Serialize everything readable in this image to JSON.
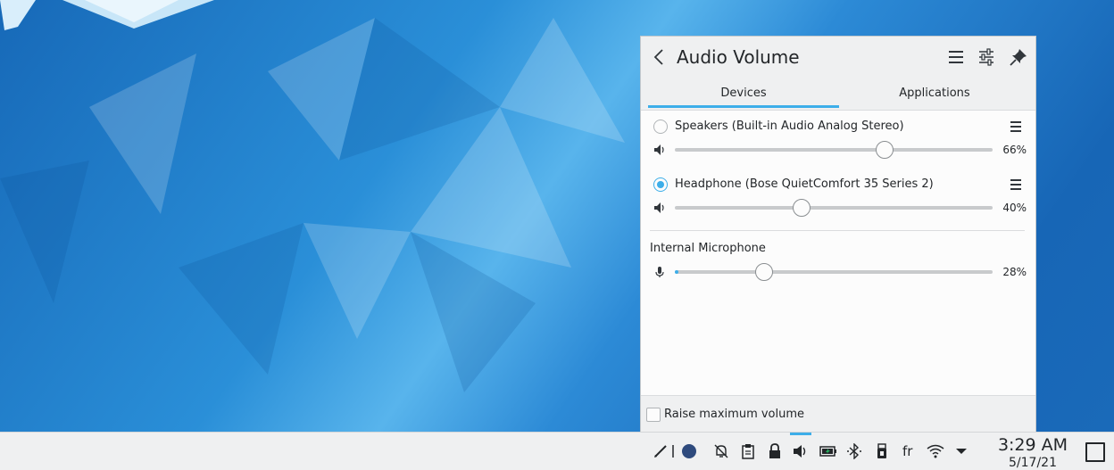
{
  "panel": {
    "title": "Audio Volume",
    "tabs": [
      {
        "label": "Devices",
        "active": true
      },
      {
        "label": "Applications",
        "active": false
      }
    ],
    "devices": [
      {
        "name": "Speakers (Built-in Audio Analog Stereo)",
        "selected": false,
        "volume": 66,
        "volume_text": "66%"
      },
      {
        "name": "Headphone (Bose QuietComfort 35 Series 2)",
        "selected": true,
        "volume": 40,
        "volume_text": "40%"
      }
    ],
    "microphone": {
      "label": "Internal Microphone",
      "volume": 28,
      "volume_text": "28%"
    },
    "footer": {
      "raise_max_label": "Raise maximum volume",
      "checked": false
    }
  },
  "taskbar": {
    "tray_icons": [
      "pen-icon",
      "separator-icon",
      "color-dot-icon",
      "notifications-disabled-icon",
      "clipboard-icon",
      "lock-icon",
      "volume-icon",
      "battery-icon",
      "bluetooth-icon",
      "usb-device-icon",
      "keyboard-layout-icon",
      "wifi-icon",
      "expand-tray-icon"
    ],
    "keyboard_layout": "fr",
    "clock_time": "3:29 AM",
    "clock_date": "5/17/21"
  },
  "colors": {
    "accent": "#3daee9",
    "panel_bg": "#eff0f1",
    "content_bg": "#fcfcfc",
    "text": "#232629"
  }
}
